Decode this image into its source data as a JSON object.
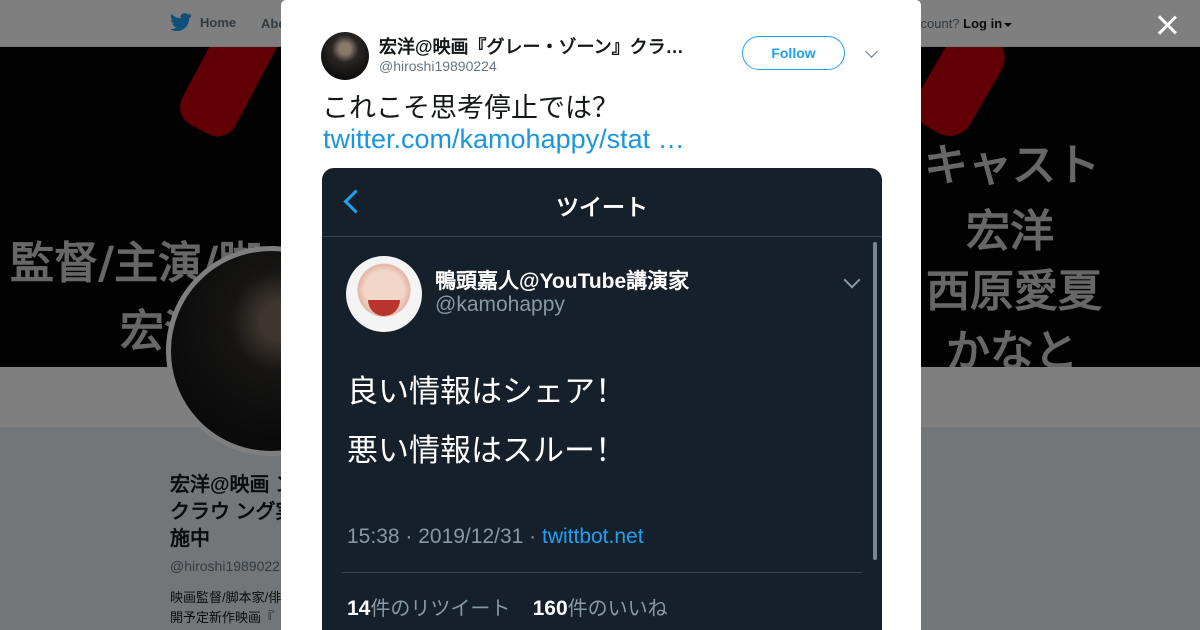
{
  "nav": {
    "home": "Home",
    "about": "Abo",
    "account_question": "ccount?",
    "login": "Log in"
  },
  "banner": {
    "left_line1": "監督/主演/脚",
    "left_line2": "宏洋",
    "right_line1": "キャスト",
    "right_line2": "宏洋",
    "right_line3": "西原愛夏",
    "right_line4": "かなと"
  },
  "profile": {
    "name": "宏洋@映画『グレー・ゾーン』クラウドファンディング実施中",
    "name_visible": "宏洋@映画 ン』クラウ ング実施中",
    "handle": "@hiroshi1989022",
    "bio_line1": "映画監督/脚本家/俳",
    "bio_line2": "開予定新作映画『"
  },
  "tweet": {
    "author_name": "宏洋@映画『グレー・ゾーン』クラ…",
    "author_handle": "@hiroshi19890224",
    "follow_label": "Follow",
    "text": "これこそ思考停止では？",
    "link": "twitter.com/kamohappy/stat …"
  },
  "embedded": {
    "header_title": "ツイート",
    "author_name": "鴨頭嘉人@YouTube講演家",
    "author_handle": "@kamohappy",
    "line1": "良い情報はシェア！",
    "line2": "悪い情報はスルー！",
    "meta": "15:38 · 2019/12/31 · ",
    "source": "twittbot.net",
    "retweets_count": "14",
    "retweets_label": "件のリツイート",
    "likes_count": "160",
    "likes_label": "件のいいね"
  },
  "colors": {
    "twitter_blue": "#1da1f2",
    "link_blue": "#1b95e0",
    "dark_bg": "#15202b",
    "banner_red": "#c3000b"
  },
  "icons": [
    "twitter-bird-icon",
    "close-icon",
    "chevron-down-icon",
    "back-chevron-icon"
  ]
}
